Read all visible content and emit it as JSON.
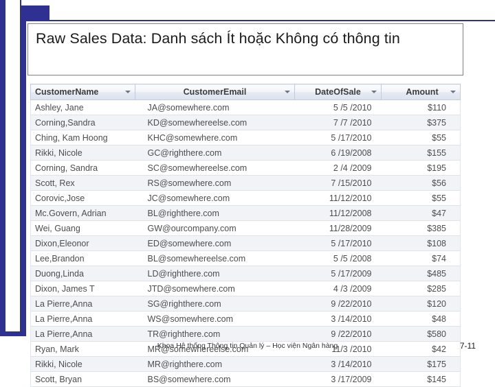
{
  "slide": {
    "title": "Raw Sales Data: Danh sách Ít hoặc Không có thông tin",
    "footer_note": "Khoa Hệ thống Thông tin Quản lý – Học viện Ngân hàng",
    "page_number": "7-11",
    "accent_color": "#2e3192"
  },
  "table": {
    "headers": [
      "CustomerName",
      "CustomerEmail",
      "DateOfSale",
      "Amount"
    ],
    "rows": [
      [
        "Ashley, Jane",
        "JA@somewhere.com",
        "5 /5 /2010",
        "$110"
      ],
      [
        "Corning,Sandra",
        "KD@somewhereelse.com",
        "7 /7 /2010",
        "$375"
      ],
      [
        "Ching, Kam Hoong",
        "KHC@somewhere.com",
        "5 /17/2010",
        "$55"
      ],
      [
        "Rikki, Nicole",
        "GC@righthere.com",
        "6 /19/2008",
        "$155"
      ],
      [
        "Corning, Sandra",
        "SC@somewhereelse.com",
        "2 /4 /2009",
        "$195"
      ],
      [
        "Scott, Rex",
        "RS@somewhere.com",
        "7 /15/2010",
        "$56"
      ],
      [
        "Corovic,Jose",
        "JC@somewhere.com",
        "11/12/2010",
        "$55"
      ],
      [
        "Mc.Govern, Adrian",
        "BL@righthere.com",
        "11/12/2008",
        "$47"
      ],
      [
        "Wei, Guang",
        "GW@ourcompany.com",
        "11/28/2009",
        "$385"
      ],
      [
        "Dixon,Eleonor",
        "ED@somewhere.com",
        "5 /17/2010",
        "$108"
      ],
      [
        "Lee,Brandon",
        "BL@somewhereelse.com",
        "5 /5 /2008",
        "$74"
      ],
      [
        "Duong,Linda",
        "LD@righthere.com",
        "5 /17/2009",
        "$485"
      ],
      [
        "Dixon, James T",
        "JTD@somewhere.com",
        "4 /3 /2009",
        "$285"
      ],
      [
        "La Pierre,Anna",
        "SG@righthere.com",
        "9 /22/2010",
        "$120"
      ],
      [
        "La Pierre,Anna",
        "WS@somewhere.com",
        "3 /14/2010",
        "$48"
      ],
      [
        "La Pierre,Anna",
        "TR@righthere.com",
        "9 /22/2010",
        "$580"
      ],
      [
        "Ryan, Mark",
        "MR@somewhereelse.com",
        "11/3 /2010",
        "$42"
      ],
      [
        "Rikki, Nicole",
        "MR@righthere.com",
        "3 /14/2010",
        "$175"
      ],
      [
        "Scott, Bryan",
        "BS@somewhere.com",
        "3 /17/2009",
        "$145"
      ]
    ]
  }
}
